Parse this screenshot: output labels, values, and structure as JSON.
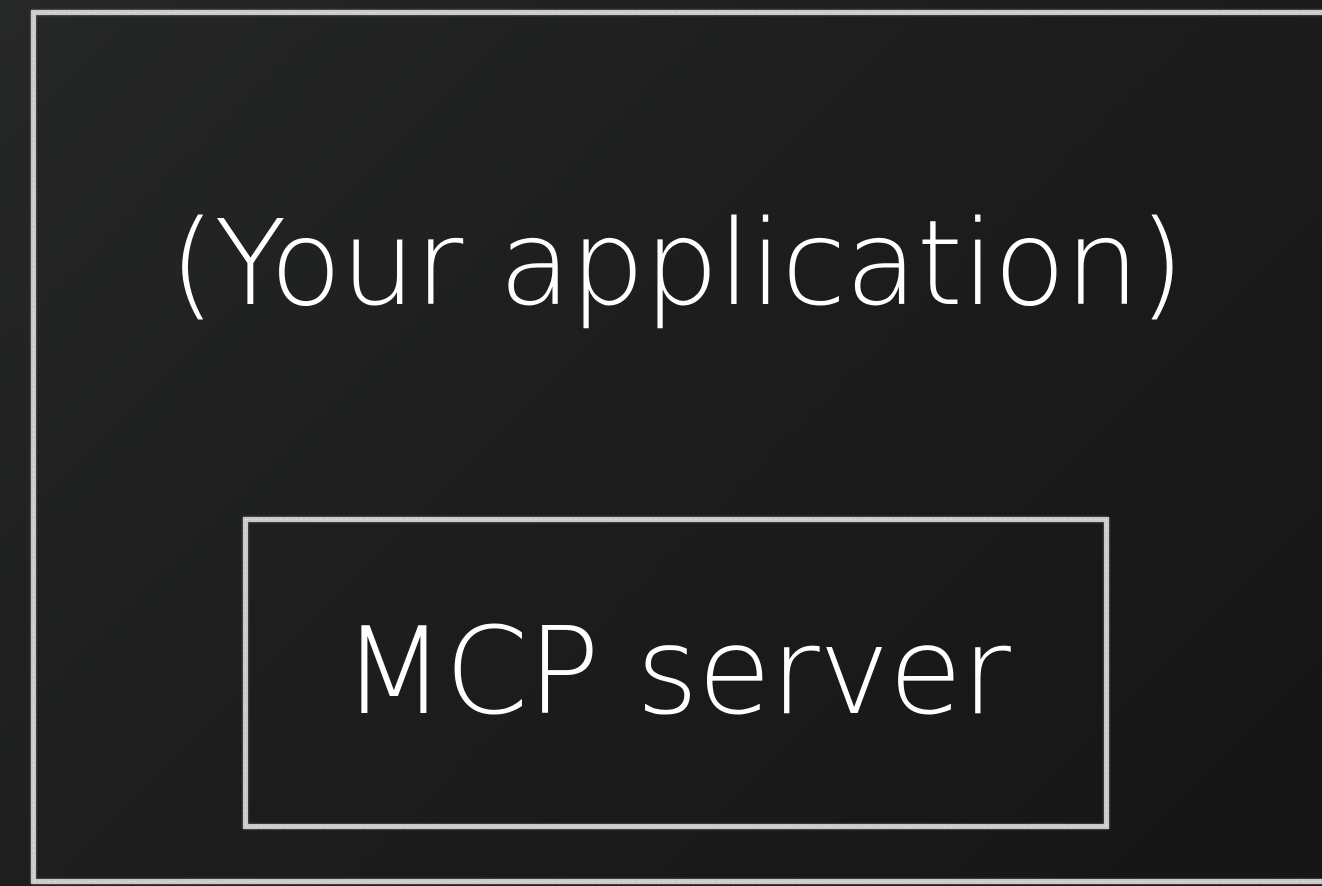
{
  "diagram": {
    "outer_box": {
      "label": "(Your application)"
    },
    "inner_box": {
      "label": "MCP server"
    }
  },
  "colors": {
    "background": "#1c1d1c",
    "border": "#c9c9c9",
    "text": "#ffffff"
  }
}
